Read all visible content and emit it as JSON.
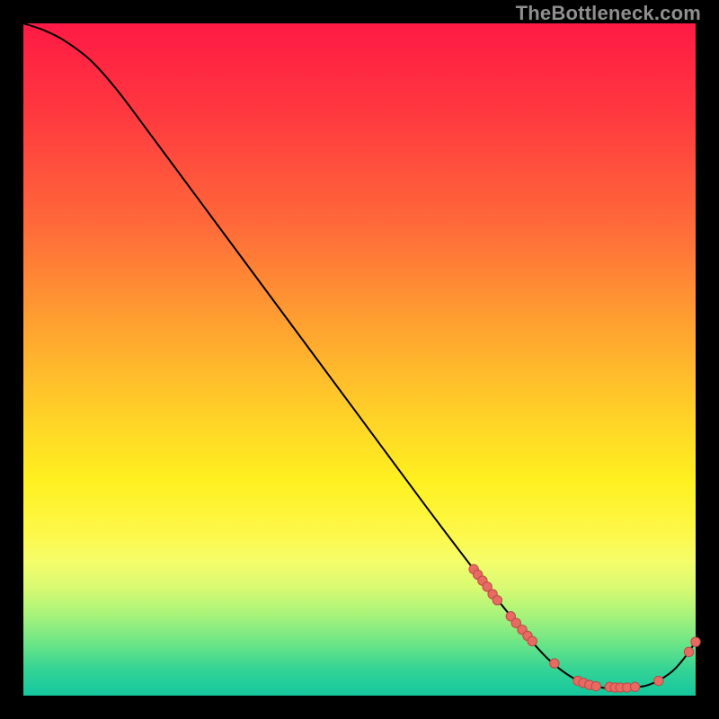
{
  "watermark": "TheBottleneck.com",
  "colors": {
    "curve": "#000000",
    "marker_fill": "#e96a63",
    "marker_stroke": "#b94b45"
  },
  "chart_data": {
    "type": "line",
    "title": "",
    "xlabel": "",
    "ylabel": "",
    "xlim": [
      0,
      100
    ],
    "ylim": [
      0,
      100
    ],
    "curve": [
      {
        "x": 0,
        "y": 100
      },
      {
        "x": 3,
        "y": 99
      },
      {
        "x": 6,
        "y": 97.5
      },
      {
        "x": 10,
        "y": 94.5
      },
      {
        "x": 14,
        "y": 90
      },
      {
        "x": 20,
        "y": 82
      },
      {
        "x": 30,
        "y": 68.5
      },
      {
        "x": 40,
        "y": 55
      },
      {
        "x": 50,
        "y": 41.5
      },
      {
        "x": 60,
        "y": 28
      },
      {
        "x": 68,
        "y": 17.5
      },
      {
        "x": 74,
        "y": 10
      },
      {
        "x": 78,
        "y": 5.5
      },
      {
        "x": 82,
        "y": 2.5
      },
      {
        "x": 86,
        "y": 1.2
      },
      {
        "x": 90,
        "y": 1.2
      },
      {
        "x": 93,
        "y": 1.6
      },
      {
        "x": 96,
        "y": 3.2
      },
      {
        "x": 98,
        "y": 5.2
      },
      {
        "x": 100,
        "y": 8
      }
    ],
    "markers": [
      {
        "x": 67.0,
        "y": 18.8
      },
      {
        "x": 67.6,
        "y": 18.0
      },
      {
        "x": 68.3,
        "y": 17.1
      },
      {
        "x": 69.0,
        "y": 16.2
      },
      {
        "x": 69.8,
        "y": 15.1
      },
      {
        "x": 70.5,
        "y": 14.2
      },
      {
        "x": 72.5,
        "y": 11.8
      },
      {
        "x": 73.3,
        "y": 10.8
      },
      {
        "x": 74.2,
        "y": 9.8
      },
      {
        "x": 75.0,
        "y": 8.9
      },
      {
        "x": 75.7,
        "y": 8.1
      },
      {
        "x": 79.0,
        "y": 4.8
      },
      {
        "x": 82.5,
        "y": 2.2
      },
      {
        "x": 83.3,
        "y": 1.9
      },
      {
        "x": 84.2,
        "y": 1.6
      },
      {
        "x": 85.2,
        "y": 1.4
      },
      {
        "x": 87.2,
        "y": 1.3
      },
      {
        "x": 88.0,
        "y": 1.2
      },
      {
        "x": 88.8,
        "y": 1.2
      },
      {
        "x": 89.8,
        "y": 1.2
      },
      {
        "x": 91.0,
        "y": 1.3
      },
      {
        "x": 94.5,
        "y": 2.2
      },
      {
        "x": 99.0,
        "y": 6.5
      },
      {
        "x": 100.0,
        "y": 8.0
      }
    ]
  }
}
